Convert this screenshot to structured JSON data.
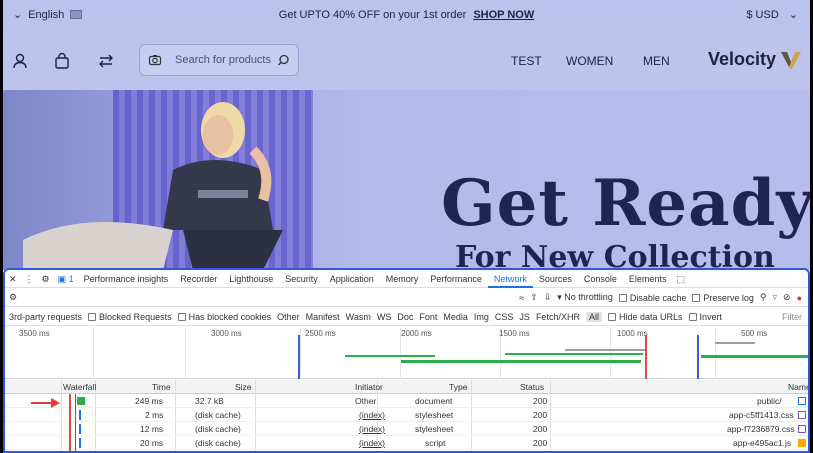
{
  "topbar": {
    "language": "English",
    "promo": "Get UPTO 40% OFF on your 1st order",
    "shop_now": "SHOP NOW",
    "currency": "$ USD"
  },
  "header": {
    "search_placeholder": "Search for products",
    "nav": [
      "TEST",
      "WOMEN",
      "MEN"
    ],
    "logo": "Velocity"
  },
  "hero": {
    "title": "Get Ready",
    "subtitle": "For New Collection"
  },
  "devtools": {
    "tabs": [
      "Performance insights",
      "Recorder",
      "Lighthouse",
      "Security",
      "Application",
      "Memory",
      "Performance",
      "Network",
      "Sources",
      "Console",
      "Elements"
    ],
    "active_tab": "Network",
    "toolbar1": {
      "preserve_log": "Preserve log",
      "disable_cache": "Disable cache",
      "throttling": "No throttling"
    },
    "toolbar2": {
      "filter_placeholder": "Filter",
      "invert": "Invert",
      "hide_data_urls": "Hide data URLs",
      "types": [
        "All",
        "Fetch/XHR",
        "JS",
        "CSS",
        "Img",
        "Media",
        "Font",
        "Doc",
        "WS",
        "Wasm",
        "Manifest",
        "Other"
      ],
      "blocked_cookies": "Has blocked cookies",
      "blocked_requests": "Blocked Requests",
      "third_party": "3rd-party requests"
    },
    "timeline_ticks": [
      "500 ms",
      "1000 ms",
      "1500 ms",
      "2000 ms",
      "2500 ms",
      "3000 ms",
      "3500 ms"
    ],
    "columns": [
      "Name",
      "Status",
      "Type",
      "Initiator",
      "Size",
      "Time",
      "Waterfall"
    ],
    "rows": [
      {
        "name": "public/",
        "status": "200",
        "type": "document",
        "initiator": "Other",
        "size": "32.7 kB",
        "time": "249 ms"
      },
      {
        "name": "app-c5ff1413.css",
        "status": "200",
        "type": "stylesheet",
        "initiator": "(index)",
        "size": "(disk cache)",
        "time": "2 ms"
      },
      {
        "name": "app-f7236879.css",
        "status": "200",
        "type": "stylesheet",
        "initiator": "(index)",
        "size": "(disk cache)",
        "time": "12 ms"
      },
      {
        "name": "app-e495ac1.js",
        "status": "200",
        "type": "script",
        "initiator": "(index)",
        "size": "(disk cache)",
        "time": "20 ms"
      }
    ]
  }
}
